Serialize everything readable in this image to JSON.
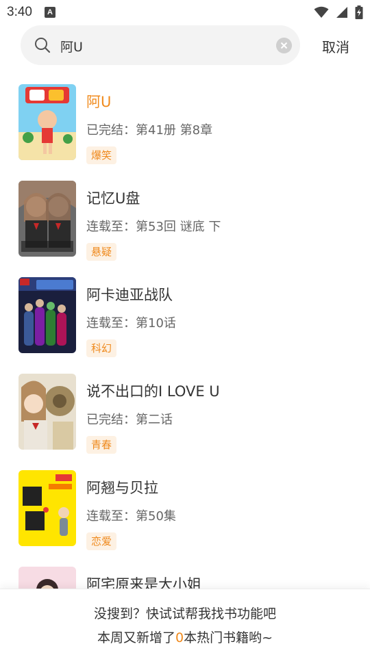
{
  "status": {
    "time": "3:40",
    "notif_icon_letter": "A"
  },
  "search": {
    "query": "阿U",
    "cancel_label": "取消"
  },
  "results": [
    {
      "title": "阿U",
      "status": "已完结：第41册 第8章",
      "tag": "爆笑",
      "highlight": true
    },
    {
      "title": "记忆U盘",
      "status": "连载至：第53回 谜底 下",
      "tag": "悬疑",
      "highlight": false
    },
    {
      "title": "阿卡迪亚战队",
      "status": "连载至：第10话",
      "tag": "科幻",
      "highlight": false
    },
    {
      "title": "说不出口的I LOVE U",
      "status": "已完结：第二话",
      "tag": "青春",
      "highlight": false
    },
    {
      "title": "阿翘与贝拉",
      "status": "连载至：第50集",
      "tag": "恋爱",
      "highlight": false
    },
    {
      "title": "阿宅原来是大小姐",
      "status": "",
      "tag": "",
      "highlight": false
    }
  ],
  "footer": {
    "line1": "没搜到？快试试帮我找书功能吧",
    "line2_prefix": "本周又新增了",
    "line2_count": "0",
    "line2_suffix": "本热门书籍哟~"
  },
  "colors": {
    "accent": "#f08a1c",
    "tag_bg": "#fdf1e3",
    "search_bg": "#f3f3f3"
  }
}
